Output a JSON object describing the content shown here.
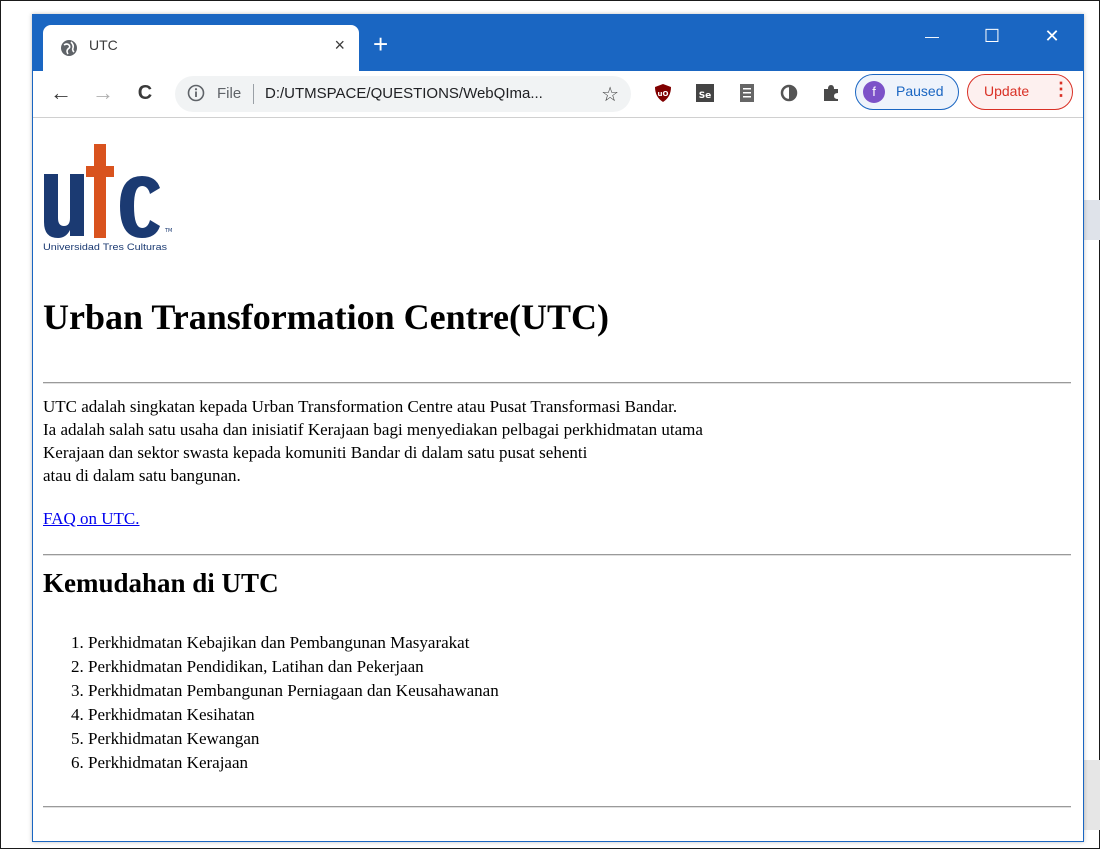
{
  "tab": {
    "title": "UTC",
    "close": "×",
    "new_tab": "+"
  },
  "window_controls": {
    "minimize": "—",
    "maximize": "☐",
    "close": "✕"
  },
  "toolbar": {
    "back": "←",
    "forward": "→",
    "reload": "C",
    "file_label": "File",
    "url": "D:/UTMSPACE/QUESTIONS/WebQIma...",
    "star": "☆",
    "extensions": [
      "ublock-icon",
      "selenium-icon",
      "reader-icon",
      "circle-extension-icon",
      "puzzle-icon"
    ],
    "profile": {
      "initial": "f",
      "label": "Paused"
    },
    "update": {
      "label": "Update",
      "menu": "⋮"
    }
  },
  "page": {
    "logo": {
      "text": "Universidad Tres Culturas",
      "letters": "utc"
    },
    "heading": "Urban Transformation Centre(UTC)",
    "paragraph": [
      "UTC adalah singkatan kepada Urban Transformation Centre atau Pusat Transformasi Bandar.",
      "Ia adalah salah satu usaha dan inisiatif Kerajaan bagi menyediakan pelbagai perkhidmatan utama",
      "Kerajaan dan sektor swasta kepada komuniti Bandar di dalam satu pusat sehenti",
      "atau di dalam satu bangunan."
    ],
    "link": "FAQ on UTC.",
    "subheading": "Kemudahan di UTC",
    "list": [
      "1. Perkhidmatan Kebajikan dan Pembangunan Masyarakat",
      "2. Perkhidmatan Pendidikan, Latihan dan Pekerjaan",
      "3. Perkhidmatan Pembangunan Perniagaan dan Keusahawanan",
      "4. Perkhidmatan Kesihatan",
      "5. Perkhidmatan Kewangan",
      "6. Perkhidmatan Kerajaan"
    ]
  },
  "colors": {
    "chrome_blue": "#1a66c2",
    "logo_navy": "#1b3a72",
    "logo_orange": "#d9531e",
    "link": "#0000ee"
  }
}
